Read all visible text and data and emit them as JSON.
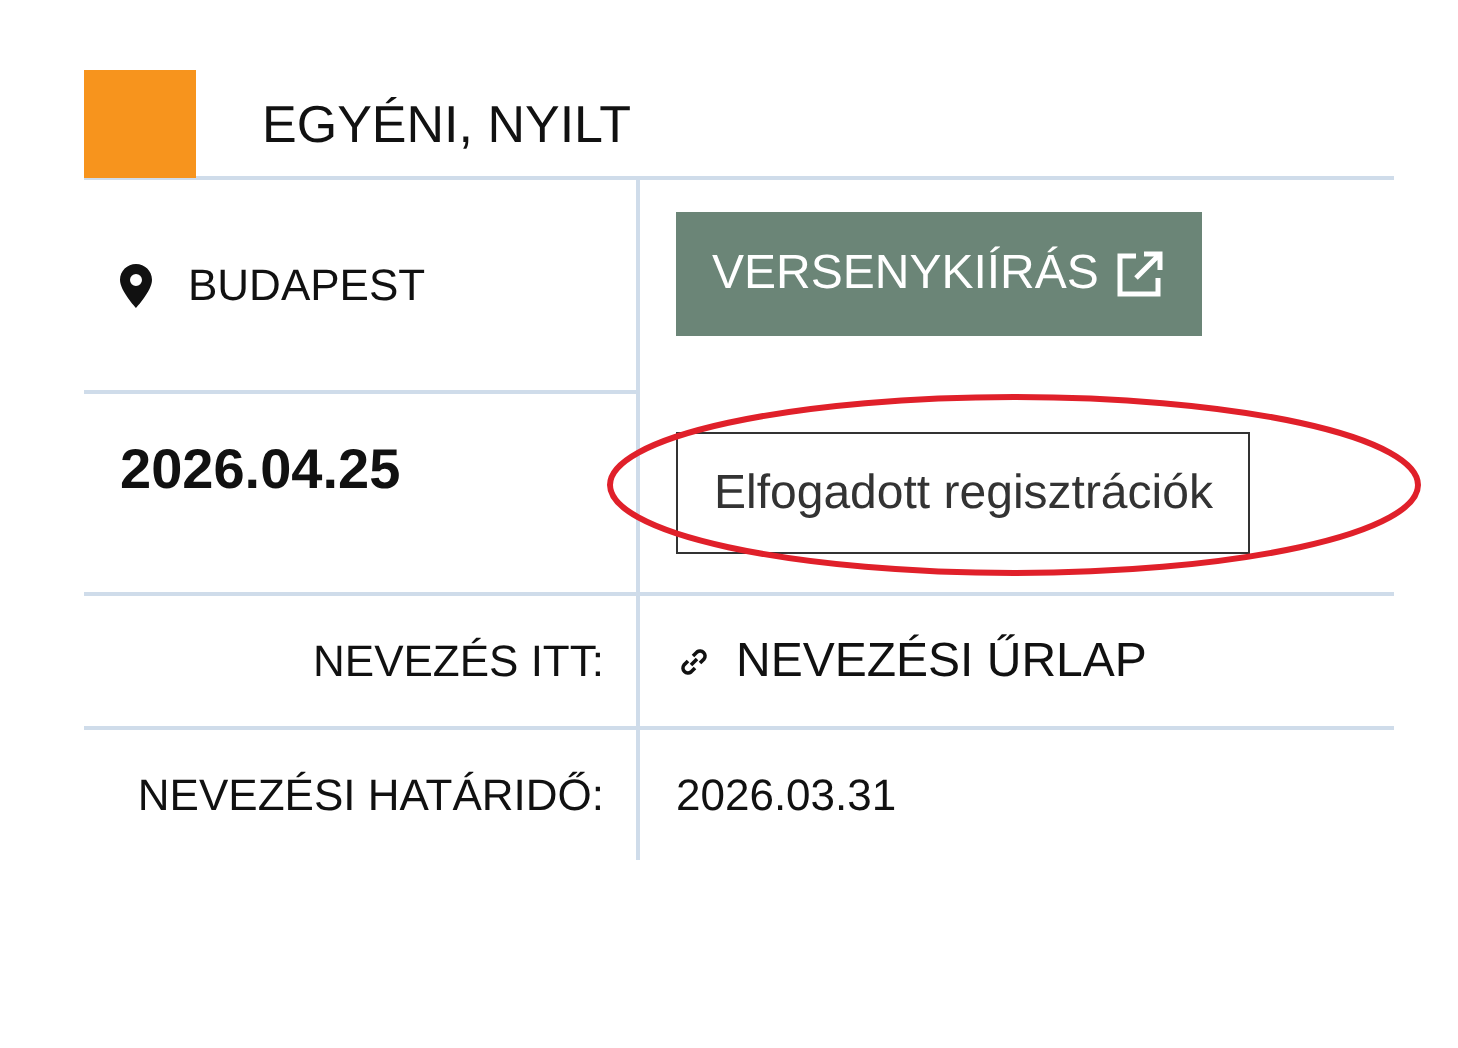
{
  "header": {
    "color": "#f7941d",
    "title": "EGYÉNI, NYILT"
  },
  "location": "BUDAPEST",
  "date": "2026.04.25",
  "buttons": [
    {
      "label": "VERSENYKIÍRÁS",
      "kind": "external",
      "highlighted": false
    },
    {
      "label": "Elfogadott regisztrációk",
      "kind": "outline",
      "highlighted": true
    }
  ],
  "rows": [
    {
      "label": "NEVEZÉS ITT:",
      "value": "NEVEZÉSI ŰRLAP",
      "kind": "link"
    },
    {
      "label": "NEVEZÉSI HATÁRIDŐ:",
      "value": "2026.03.31",
      "kind": "text"
    }
  ]
}
